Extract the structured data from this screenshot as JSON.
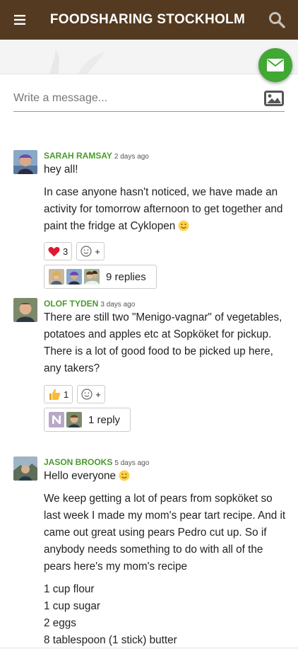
{
  "header": {
    "title": "FOODSHARING STOCKHOLM"
  },
  "compose": {
    "placeholder": "Write a message..."
  },
  "colors": {
    "topbar": "#533a20",
    "fab": "#41a833",
    "author": "#4a9a2c"
  },
  "posts": [
    {
      "author": "SARAH RAMSAY",
      "time": "2 days ago",
      "lines": [
        "hey all!"
      ],
      "paragraph": "In case anyone hasn't noticed, we have made an activity for tomorrow afternoon to get together and paint the fridge at Cyklopen",
      "reaction": {
        "icon": "heart-icon",
        "count": "3"
      },
      "add_reaction": "+",
      "replies": "9 replies"
    },
    {
      "author": "OLOF TYDEN",
      "time": "3 days ago",
      "lines": [
        "There are still two \"Menigo-vagnar\" of vegetables, potatoes and apples etc at Sopköket for pickup.",
        "There is a lot of good food to be picked up here, any takers?"
      ],
      "reaction": {
        "icon": "thumbs-up-icon",
        "count": "1"
      },
      "add_reaction": "+",
      "replies": "1 reply"
    },
    {
      "author": "JASON BROOKS",
      "time": "5 days ago",
      "lines": [
        "Hello everyone"
      ],
      "paragraph": "We keep getting a lot of pears from sopköket so last week I made my mom's pear tart recipe. And it came out great using pears Pedro cut up. So if anybody needs something to do with all of the pears here's my mom's recipe",
      "recipe": [
        "1 cup flour",
        "1 cup sugar",
        "2 eggs",
        "8 tablespoon (1 stick) butter"
      ]
    }
  ]
}
